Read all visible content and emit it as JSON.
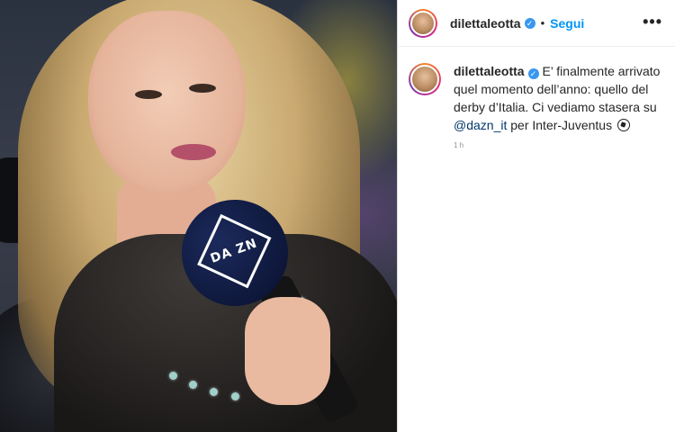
{
  "header": {
    "username": "dilettaleotta",
    "separator": "•",
    "follow_label": "Segui",
    "more_label": "•••"
  },
  "caption": {
    "username": "dilettaleotta",
    "text_part1": " E’ finalmente arrivato quel momento dell’anno: quello del derby d’Italia. Ci vediamo stasera su ",
    "mention": "@dazn_it",
    "text_part2": " per Inter-Juventus "
  },
  "timestamp": "1 h",
  "photo": {
    "mic_logo": "DA ZN"
  },
  "colors": {
    "follow": "#0095f6",
    "verified": "#3897f0",
    "mention": "#00376b"
  },
  "icons": {
    "verified": "verified-badge-icon",
    "more": "more-options-icon",
    "ball": "soccer-ball-icon"
  }
}
